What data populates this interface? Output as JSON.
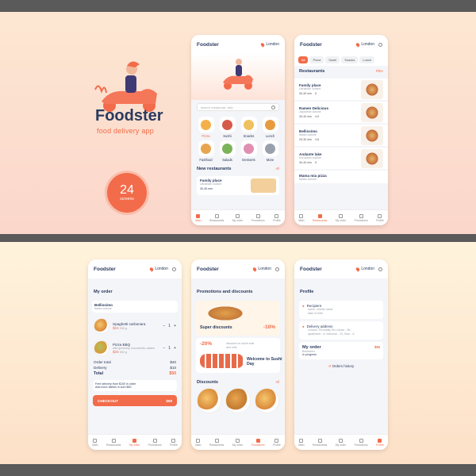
{
  "brand": {
    "title": "Foodster",
    "subtitle": "food delivery app",
    "screens_count": "24",
    "screens_label": "screens"
  },
  "header": {
    "logo": "Foodster",
    "location": "London"
  },
  "home": {
    "search_placeholder": "search restaurant, dish",
    "categories": [
      {
        "label": "Pizza",
        "color": "#f5b04a"
      },
      {
        "label": "Sushi",
        "color": "#d65a4a"
      },
      {
        "label": "Snacks",
        "color": "#f0c060"
      },
      {
        "label": "Lunch",
        "color": "#e79b3f"
      },
      {
        "label": "Fastfood",
        "color": "#e8a550"
      },
      {
        "label": "Salads",
        "color": "#7bb35a"
      },
      {
        "label": "Desserts",
        "color": "#e08fb2"
      },
      {
        "label": "More",
        "color": "#9aa0ab"
      }
    ],
    "new_restaurants_title": "New restaurants",
    "all_label": "All",
    "card": {
      "name": "Family place",
      "cuisine": "Ukrainian cuisine",
      "time": "30-45 min"
    }
  },
  "restaurants": {
    "chips": [
      "All",
      "Pizza",
      "Sushi",
      "Snacks",
      "Lunch"
    ],
    "title": "Restaurants",
    "filter": "Filter",
    "items": [
      {
        "name": "Family place",
        "cuisine": "Ukrainian cuisine",
        "time": "30-40 min",
        "rating": "5"
      },
      {
        "name": "Ramen Delicious",
        "cuisine": "Japanese cuisine",
        "time": "30-40 min",
        "rating": "4.5"
      },
      {
        "name": "Bellissimo",
        "cuisine": "Italian cuisine",
        "time": "25-30 min",
        "rating": "4.8"
      },
      {
        "name": "Andante lake",
        "cuisine": "European cuisine",
        "time": "30-40 min",
        "rating": "5"
      },
      {
        "name": "Mama mia pizza",
        "cuisine": "Italian cuisine",
        "time": "",
        "rating": ""
      }
    ]
  },
  "order": {
    "title": "My order",
    "restaurant": "Bellissimo",
    "restaurant_cuisine": "Italian cuisine",
    "items": [
      {
        "name": "Spaghetti carbonara",
        "price": "$15",
        "weight": "330 g",
        "qty": "1"
      },
      {
        "name": "Pizza BBQ",
        "desc": "with greenery, mozzarella, salami",
        "price": "$25",
        "weight": "500 g",
        "qty": "1"
      }
    ],
    "order_total_label": "Order total",
    "order_total": "$40",
    "delivery_label": "Delivery",
    "delivery": "$10",
    "total_label": "Total",
    "total": "$50",
    "free_delivery": "Free delivery from $100 in order",
    "free_delivery_2": "Add more dishes in sum $50",
    "checkout": "CHECKOUT",
    "checkout_price": "$59"
  },
  "promotions": {
    "title": "Promotions and discounts",
    "promo1_text": "Super discounts",
    "promo1_pct": "-10%",
    "promo2_pct": "-20%",
    "promo2_small": "discount on sushi sets and rolls",
    "promo2_text": "Welcome to Sushi Day",
    "discounts_title": "Discounts",
    "all_label": "All"
  },
  "profile": {
    "title": "Profile",
    "recipient_label": "Recipient",
    "recipient_lines": [
      "name, middle name",
      "date of birth"
    ],
    "address_label": "Delivery address",
    "address_lines": [
      "London, Piccadilly Rd, house - 5b,",
      "apartment - 6, intercom - 01, floor - 6"
    ],
    "my_order_label": "My order",
    "my_order_price": "$50",
    "my_order_rest": "Bellissimo",
    "my_order_status": "In progress",
    "history": "Orders history"
  },
  "nav": {
    "items": [
      "Main",
      "Restaurants",
      "My order",
      "Promotions",
      "Profile"
    ]
  },
  "colors": {
    "accent": "#f26b4a",
    "navy": "#2a3a5e"
  }
}
